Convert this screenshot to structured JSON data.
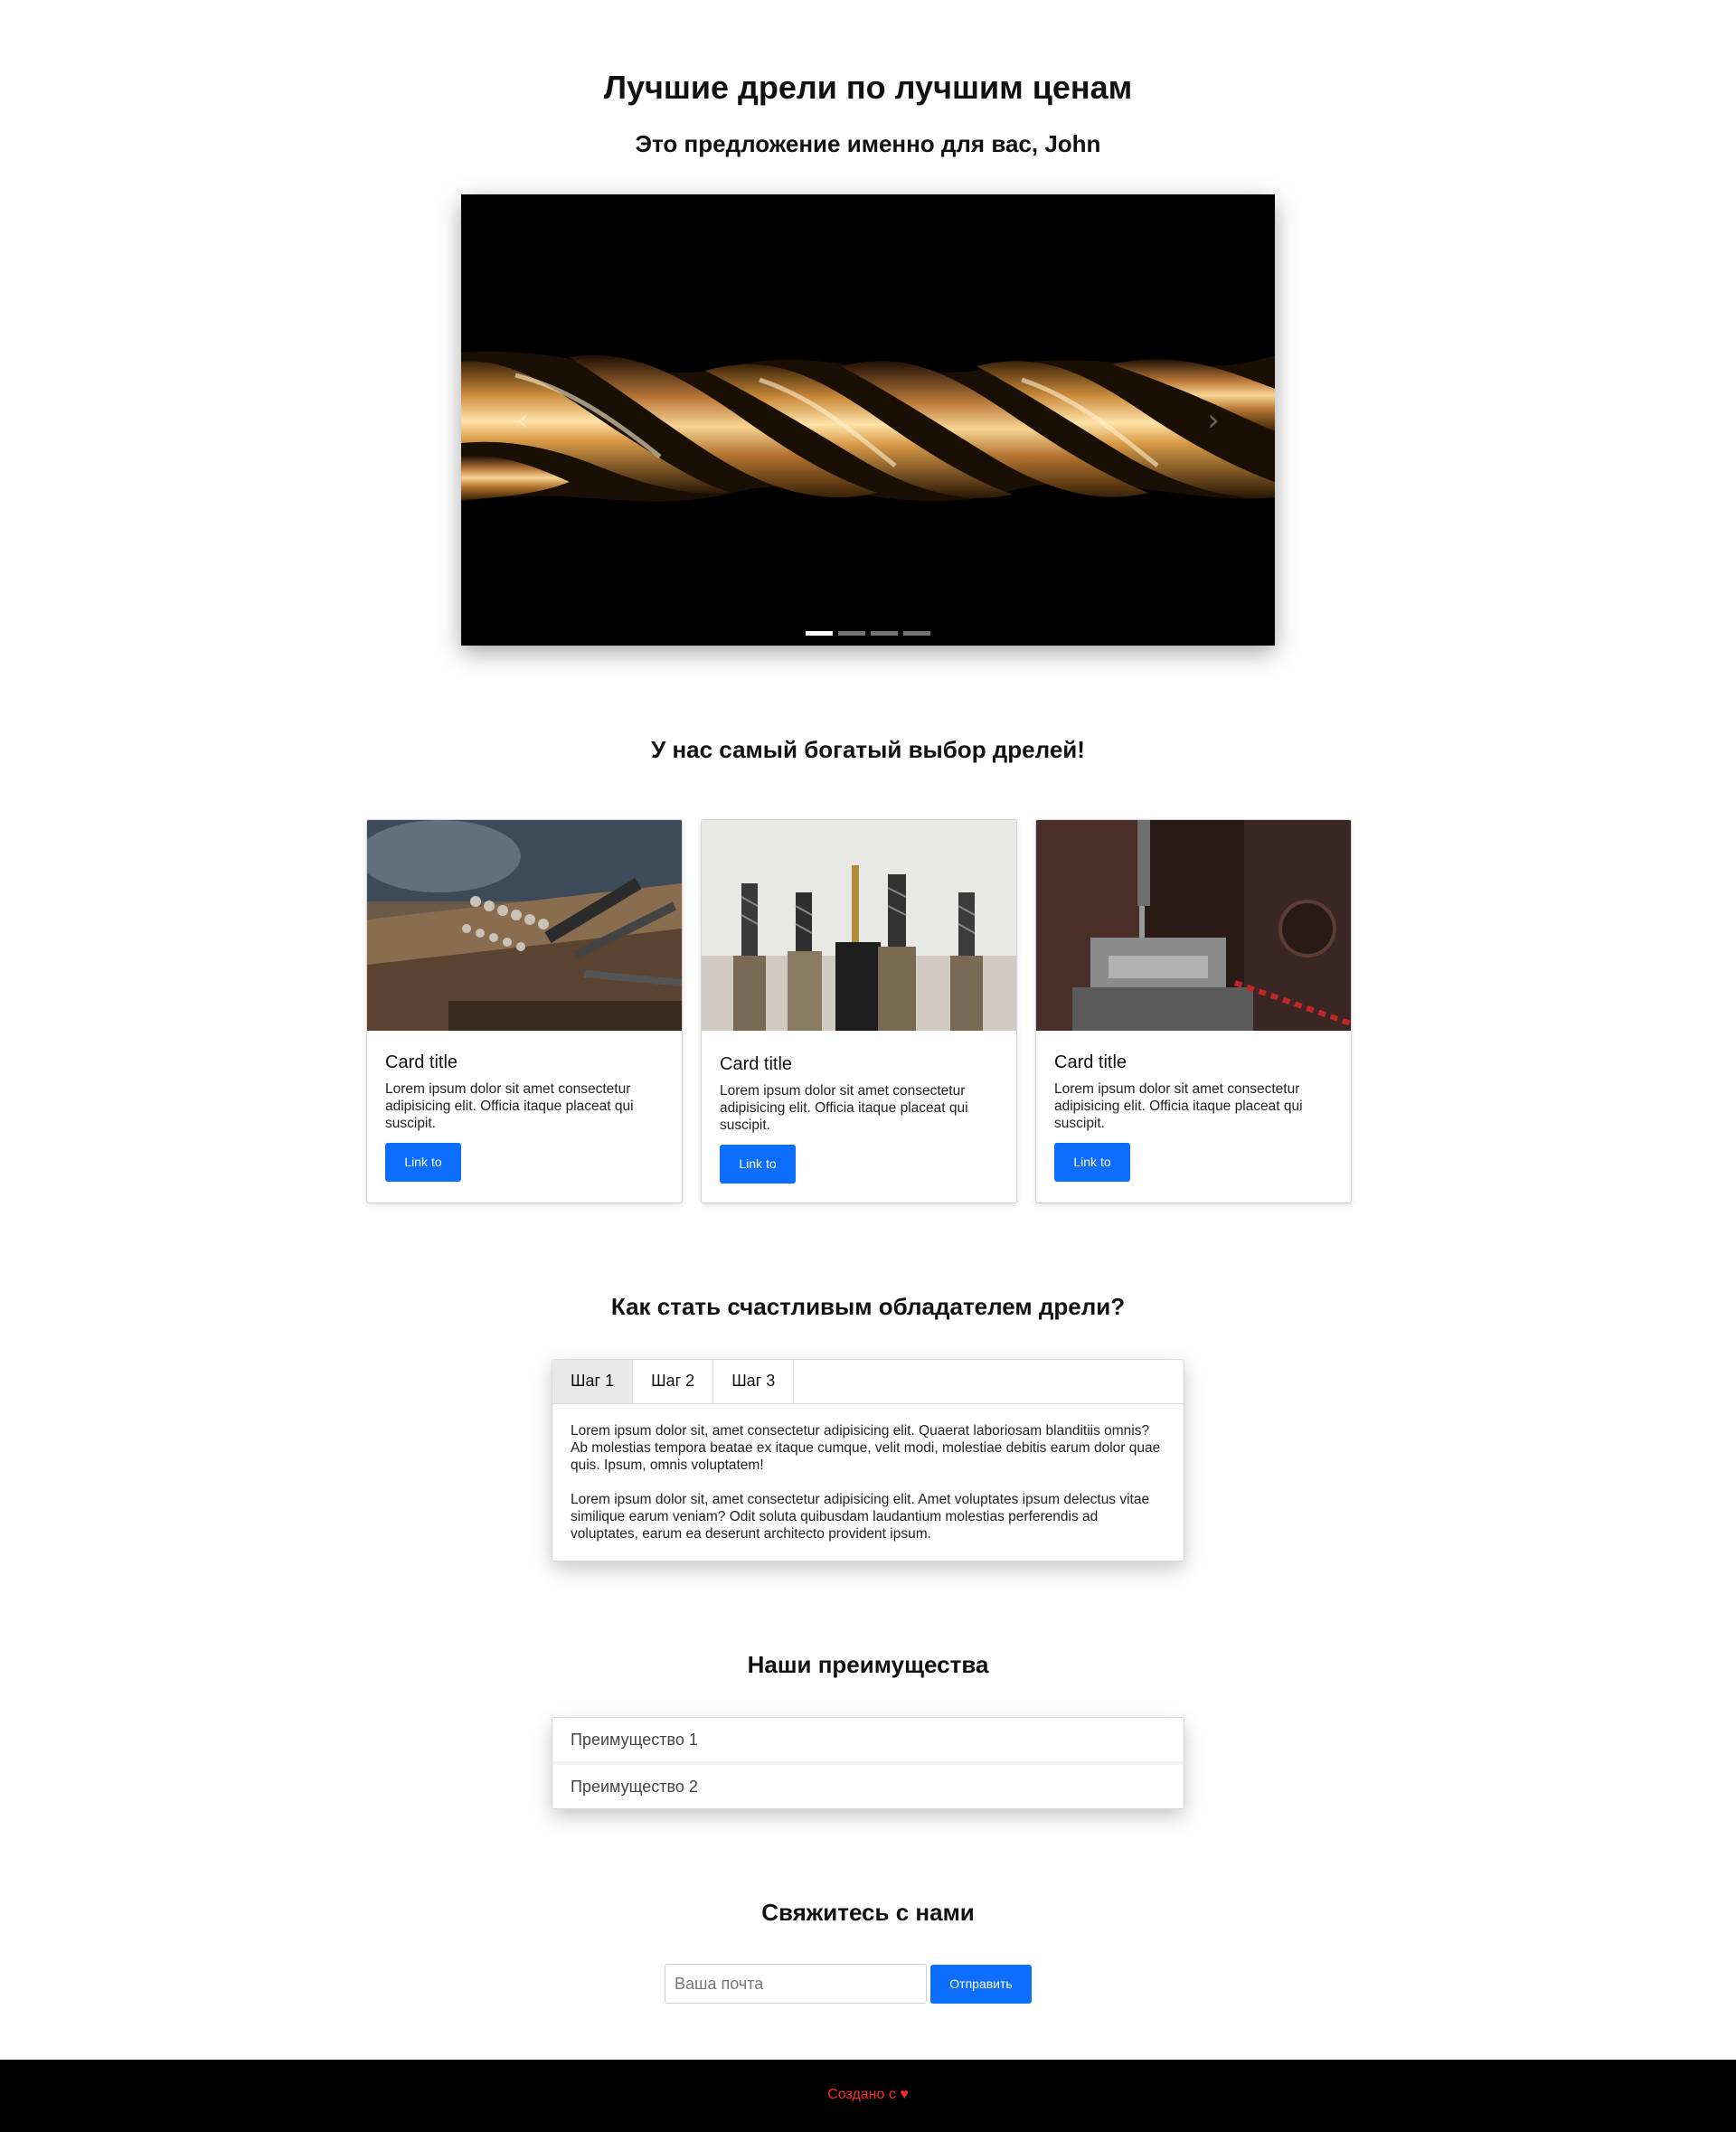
{
  "header": {
    "title": "Лучшие дрели по лучшим ценам",
    "subtitle": "Это предложение именно для вас, John"
  },
  "carousel": {
    "prev_icon": "chevron-left-icon",
    "next_icon": "chevron-right-icon",
    "prev_glyph": "‹",
    "next_glyph": "›",
    "slide_count": 4,
    "active_slide": 1
  },
  "products": {
    "heading": "У нас самый богатый выбор дрелей!",
    "cards": [
      {
        "title": "Card title",
        "text": "Lorem ipsum dolor sit amet consectetur adipisicing elit. Officia itaque placeat qui suscipit.",
        "button": "Link to"
      },
      {
        "title": "Card title",
        "text": "Lorem ipsum dolor sit amet consectetur adipisicing elit. Officia itaque placeat qui suscipit.",
        "button": "Link to"
      },
      {
        "title": "Card title",
        "text": "Lorem ipsum dolor sit amet consectetur adipisicing elit. Officia itaque placeat qui suscipit.",
        "button": "Link to"
      }
    ]
  },
  "steps": {
    "heading": "Как стать счастливым обладателем дрели?",
    "tabs": [
      "Шаг 1",
      "Шаг 2",
      "Шаг 3"
    ],
    "active_tab": 0,
    "paragraphs": [
      "Lorem ipsum dolor sit, amet consectetur adipisicing elit. Quaerat laboriosam blanditiis omnis? Ab molestias tempora beatae ex itaque cumque, velit modi, molestiae debitis earum dolor quae quis. Ipsum, omnis voluptatem!",
      "Lorem ipsum dolor sit, amet consectetur adipisicing elit. Amet voluptates ipsum delectus vitae similique earum veniam? Odit soluta quibusdam laudantium molestias perferendis ad voluptates, earum ea deserunt architecto provident ipsum."
    ]
  },
  "advantages": {
    "heading": "Наши преимущества",
    "items": [
      "Преимущество 1",
      "Преимущество 2"
    ]
  },
  "contact": {
    "heading": "Свяжитесь с нами",
    "email_placeholder": "Ваша почта",
    "email_value": "",
    "submit": "Отправить"
  },
  "footer": {
    "text": "Создано с",
    "heart": "♥",
    "heart_icon": "heart-icon"
  },
  "colors": {
    "primary": "#0d6efd",
    "footer_bg": "#000000",
    "footer_text": "#ff2b2b"
  }
}
